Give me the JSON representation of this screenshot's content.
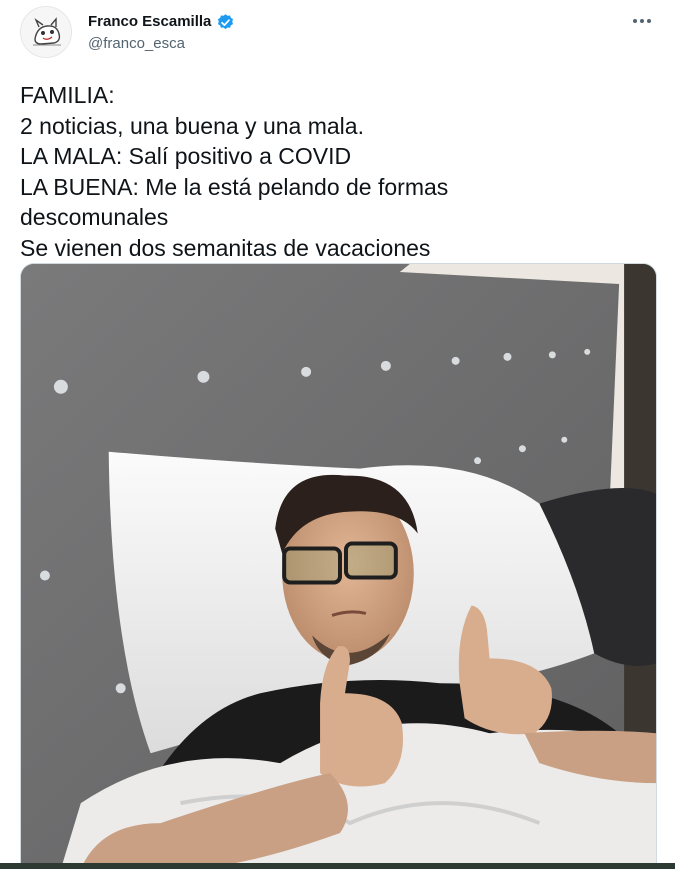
{
  "tweet": {
    "author": {
      "display_name": "Franco Escamilla",
      "handle": "@franco_esca",
      "verified": true,
      "avatar_icon": "avatar-drawing-icon"
    },
    "more_icon": "more-horizontal-icon",
    "text_lines": [
      "FAMILIA:",
      "2 noticias, una buena y una mala.",
      "LA MALA: Salí positivo a COVID",
      "LA BUENA: Me la está pelando de formas",
      "descomunales",
      "Se vienen dos semanitas de vacaciones"
    ],
    "media": {
      "kind": "photo"
    }
  },
  "colors": {
    "text": "#0f1419",
    "secondary": "#536471",
    "verified": "#1d9bf0",
    "headboard": "#6f6f70",
    "frame": "#e9e5de"
  }
}
